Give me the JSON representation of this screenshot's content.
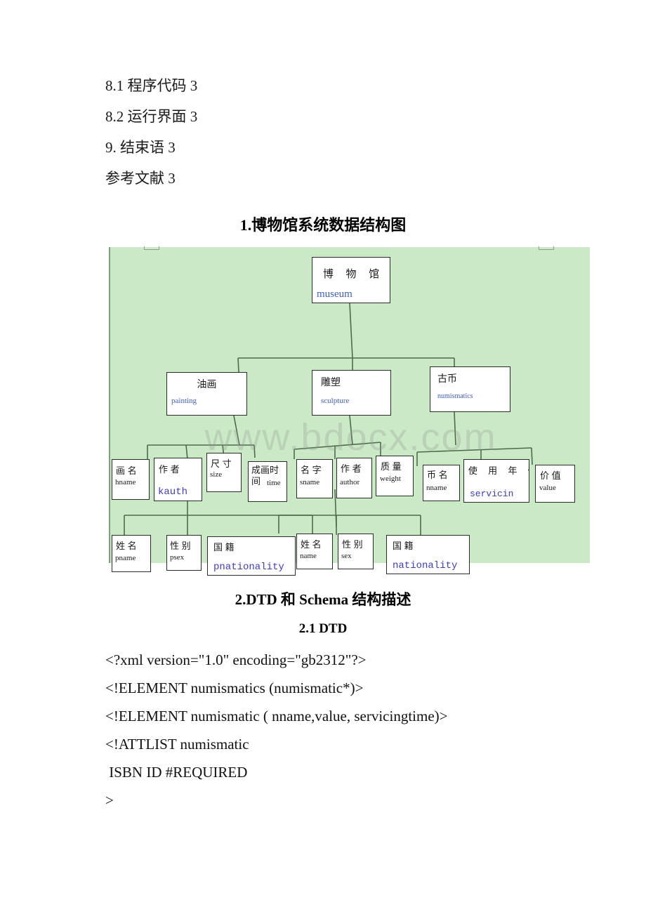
{
  "toc": {
    "lines": [
      "8.1 程序代码 3",
      "8.2 运行界面 3",
      "9. 结束语 3",
      "参考文献 3"
    ]
  },
  "headings": {
    "diagram": "1.博物馆系统数据结构图",
    "dtd": "2.DTD 和 Schema 结构描述",
    "dtd_sub": "2.1 DTD"
  },
  "diagram": {
    "background_color": "#caeac6",
    "watermark": "www.bdocx.com",
    "nodes": {
      "museum": {
        "cn": "博 物 馆",
        "en": "museum"
      },
      "painting": {
        "cn": "油画",
        "en": "painting"
      },
      "sculpture": {
        "cn": "雕塑",
        "en": "sculpture"
      },
      "numismatics": {
        "cn": "古币",
        "en": "numismatics"
      },
      "hname": {
        "cn": "画 名",
        "en": "hname"
      },
      "kauth": {
        "cn": "作 者",
        "en": "kauth"
      },
      "size": {
        "cn": "尺 寸",
        "en": "size"
      },
      "time": {
        "cn": "成画时间",
        "en": "time"
      },
      "sname": {
        "cn": "名 字",
        "en": "sname"
      },
      "author": {
        "cn": "作 者",
        "en": "author"
      },
      "weight": {
        "cn": "质 量",
        "en": "weight"
      },
      "nname": {
        "cn": "币 名",
        "en": "nname"
      },
      "servicin": {
        "cn": "使 用 年 代",
        "en": "servicin"
      },
      "value": {
        "cn": "价 值",
        "en": "value"
      },
      "pname": {
        "cn": "姓 名",
        "en": "pname"
      },
      "psex": {
        "cn": "性 别",
        "en": "psex"
      },
      "pnationality": {
        "cn": "国        籍",
        "en": "pnationality"
      },
      "name": {
        "cn": "姓 名",
        "en": "name"
      },
      "sex": {
        "cn": "性 别",
        "en": "sex"
      },
      "nationality": {
        "cn": "国        籍",
        "en": "nationality"
      }
    }
  },
  "dtd_code": {
    "lines": [
      "<?xml version=\"1.0\" encoding=\"gb2312\"?>",
      "<!ELEMENT numismatics (numismatic*)>",
      "<!ELEMENT numismatic ( nname,value, servicingtime)>",
      "<!ATTLIST numismatic",
      " ISBN ID #REQUIRED",
      ">"
    ]
  }
}
